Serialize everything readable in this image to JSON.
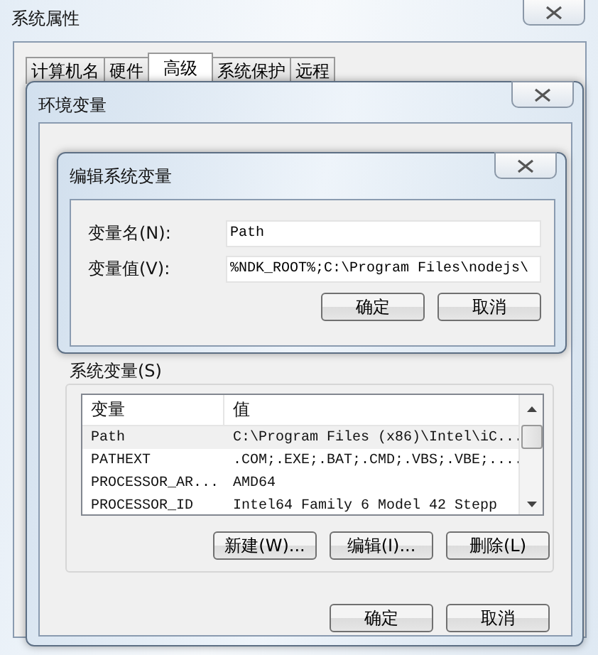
{
  "window": {
    "title": "系统属性"
  },
  "tabs": [
    {
      "label": "计算机名",
      "selected": false
    },
    {
      "label": "硬件",
      "selected": false
    },
    {
      "label": "高级",
      "selected": true
    },
    {
      "label": "系统保护",
      "selected": false
    },
    {
      "label": "远程",
      "selected": false
    }
  ],
  "env_dialog": {
    "title": "环境变量",
    "system_variables": {
      "label": "系统变量(S)",
      "columns": [
        "变量",
        "值"
      ],
      "rows": [
        {
          "name": "Path",
          "value": "C:\\Program Files (x86)\\Intel\\iC...",
          "selected": true
        },
        {
          "name": "PATHEXT",
          "value": ".COM;.EXE;.BAT;.CMD;.VBS;.VBE;....",
          "selected": false
        },
        {
          "name": "PROCESSOR_AR...",
          "value": "AMD64",
          "selected": false
        },
        {
          "name": "PROCESSOR_ID",
          "value": "Intel64 Family 6 Model 42 Stepp",
          "selected": false
        }
      ],
      "buttons": [
        "新建(W)...",
        "编辑(I)...",
        "删除(L)"
      ]
    },
    "buttons": [
      "确定",
      "取消"
    ]
  },
  "edit_dialog": {
    "title": "编辑系统变量",
    "fields": [
      {
        "label": "变量名(N):",
        "value": "Path"
      },
      {
        "label": "变量值(V):",
        "value": "%NDK_ROOT%;C:\\Program Files\\nodejs\\"
      }
    ],
    "buttons": [
      "确定",
      "取消"
    ]
  }
}
